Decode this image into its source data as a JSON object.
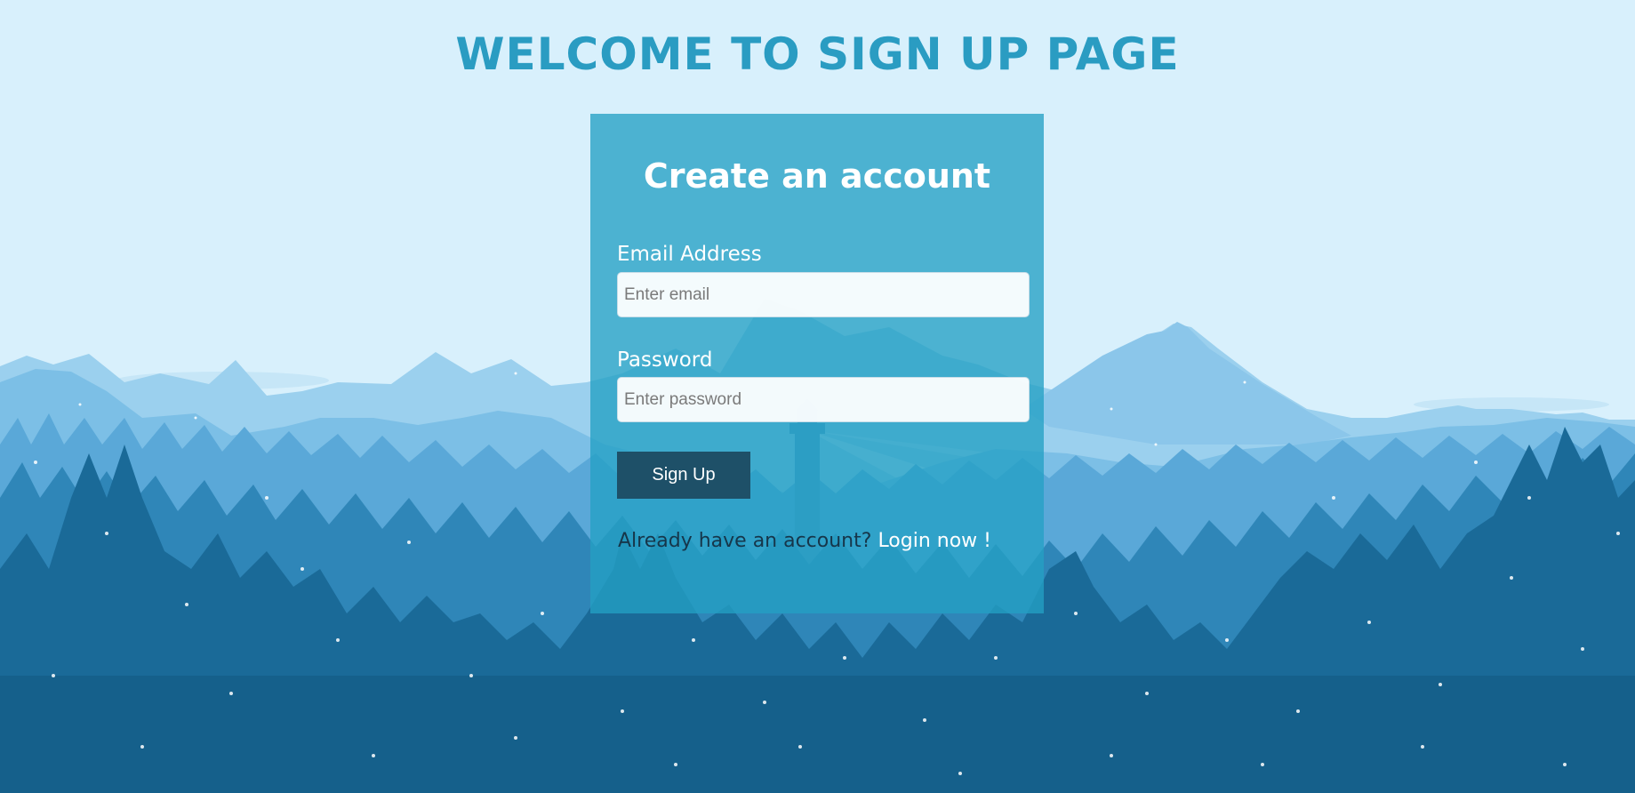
{
  "page": {
    "title": "WELCOME TO SIGN UP PAGE"
  },
  "form": {
    "heading": "Create an account",
    "email_label": "Email Address",
    "email_placeholder": "Enter email",
    "email_value": "",
    "password_label": "Password",
    "password_placeholder": "Enter password",
    "password_value": "",
    "submit_label": "Sign Up",
    "login_prompt": "Already have an account?",
    "login_link": "Login now !"
  },
  "colors": {
    "sky": "#d8f0fc",
    "title": "#2a9cc2",
    "card": "#24a0c4",
    "button": "#1e5068",
    "forest_dark": "#16648e"
  }
}
